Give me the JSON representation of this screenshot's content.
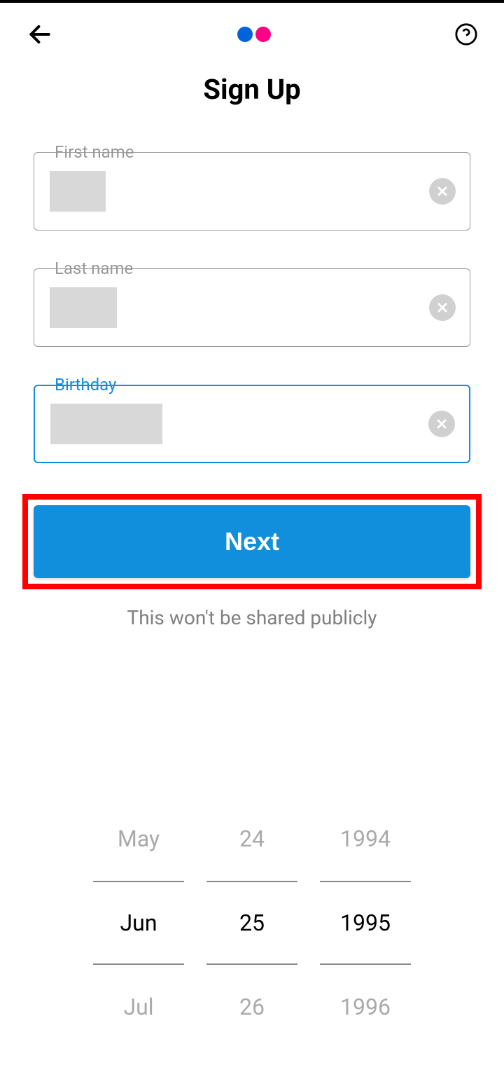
{
  "header": {
    "title": "Sign Up"
  },
  "form": {
    "first_name": {
      "label": "First name"
    },
    "last_name": {
      "label": "Last name"
    },
    "birthday": {
      "label": "Birthday"
    },
    "next_button": "Next",
    "privacy_notice": "This won't be shared publicly"
  },
  "date_picker": {
    "month": {
      "prev": "May",
      "current": "Jun",
      "next": "Jul"
    },
    "day": {
      "prev": "24",
      "current": "25",
      "next": "26"
    },
    "year": {
      "prev": "1994",
      "current": "1995",
      "next": "1996"
    }
  }
}
